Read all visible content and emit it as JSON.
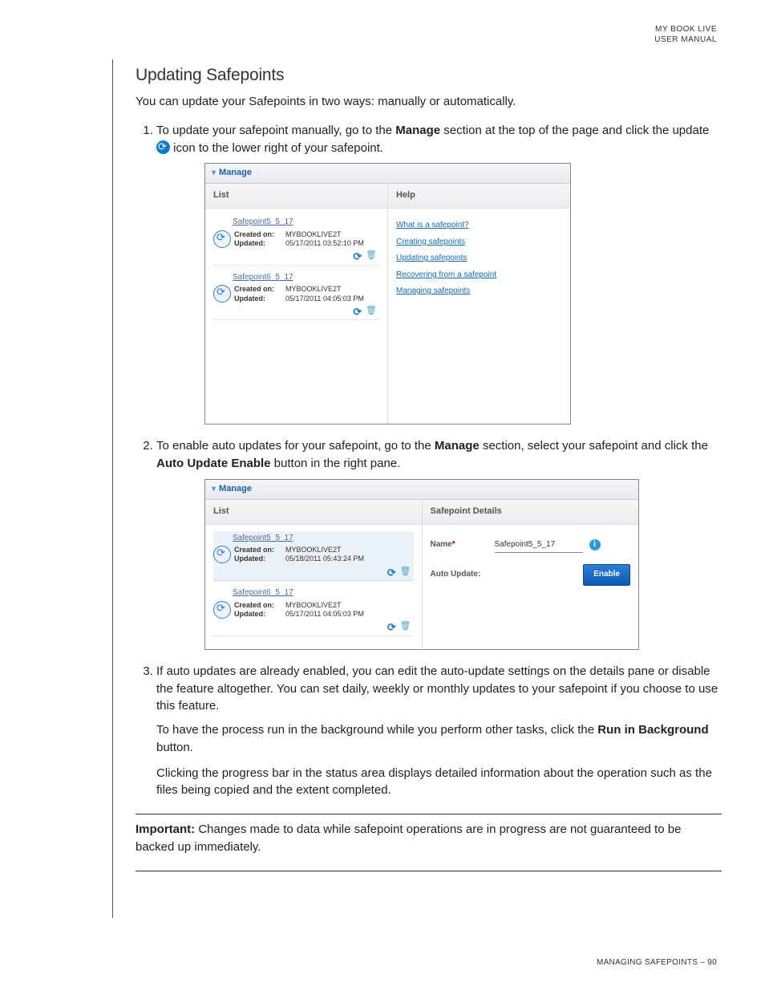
{
  "header": {
    "line1": "MY BOOK LIVE",
    "line2": "USER MANUAL"
  },
  "title": "Updating Safepoints",
  "intro": "You can update your Safepoints in two ways: manually or automatically.",
  "steps": {
    "s1a": "To update your safepoint manually, go to the ",
    "s1b": "Manage",
    "s1c": " section at the top of the page and click the update ",
    "s1d": " icon to the lower right of your safepoint.",
    "s2a": "To enable auto updates for your safepoint, go to the ",
    "s2b": "Manage",
    "s2c": " section, select your safepoint and click the ",
    "s2d": "Auto Update Enable",
    "s2e": " button in the right pane.",
    "s3": "If auto updates are already enabled, you can edit the auto-update settings on the details pane or disable the feature altogether. You can set daily, weekly or monthly updates to your safepoint if you choose to use this feature.",
    "s3p2a": "To have the process run in the background while you perform other tasks, click the ",
    "s3p2b": "Run in Background",
    "s3p2c": " button.",
    "s3p3": "Clicking the progress bar in the status area displays detailed information about the operation such as the files being copied and the extent completed."
  },
  "important": {
    "lead": "Important:",
    "text": "  Changes made to data while safepoint operations are in progress are not guaranteed to be backed up immediately."
  },
  "shot1": {
    "manage": "Manage",
    "listHead": "List",
    "helpHead": "Help",
    "items": [
      {
        "name": "Safepoint5_5_17",
        "createdLabel": "Created on:",
        "updatedLabel": "Updated:",
        "device": "MYBOOKLIVE2T",
        "date": "05/17/2011 03:52:10 PM"
      },
      {
        "name": "Safepoint6_5_17",
        "createdLabel": "Created on:",
        "updatedLabel": "Updated:",
        "device": "MYBOOKLIVE2T",
        "date": "05/17/2011 04:05:03 PM"
      }
    ],
    "helpLinks": [
      "What is a safepoint?",
      "Creating safepoints",
      "Updating safepoints",
      "Recovering from a safepoint",
      "Managing safepoints"
    ]
  },
  "shot2": {
    "manage": "Manage",
    "listHead": "List",
    "detailsHead": "Safepoint Details",
    "items": [
      {
        "name": "Safepoint5_5_17",
        "createdLabel": "Created on:",
        "updatedLabel": "Updated:",
        "device": "MYBOOKLIVE2T",
        "date": "05/18/2011 05:43:24 PM"
      },
      {
        "name": "Safepoint6_5_17",
        "createdLabel": "Created on:",
        "updatedLabel": "Updated:",
        "device": "MYBOOKLIVE2T",
        "date": "05/17/2011 04:05:03 PM"
      }
    ],
    "nameLabel": "Name",
    "nameValue": "Safepoint5_5_17",
    "autoLabel": "Auto Update:",
    "enable": "Enable"
  },
  "footer": {
    "section": "MANAGING SAFEPOINTS",
    "sep": " – ",
    "page": "90"
  }
}
